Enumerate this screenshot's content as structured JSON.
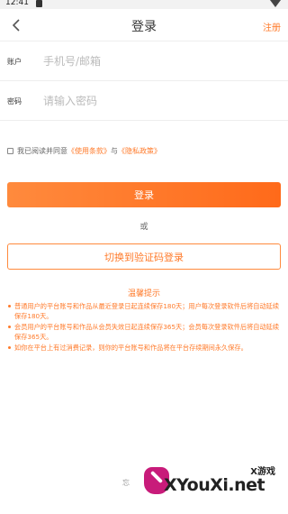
{
  "statusbar": {
    "time": "12:41"
  },
  "header": {
    "title": "登录",
    "register_label": "注册"
  },
  "account": {
    "label": "账户",
    "placeholder": "手机号/邮箱"
  },
  "password": {
    "label": "密码",
    "placeholder": "请输入密码"
  },
  "agreement": {
    "prefix": "我已阅读并同意",
    "terms": "《使用条款》",
    "and": "与",
    "privacy": "《隐私政策》"
  },
  "login_button": "登录",
  "or_text": "或",
  "switch_button": "切换到验证码登录",
  "tips": {
    "title": "温馨提示",
    "items": [
      "普通用户的平台账号和作品从最近登录日起连续保存180天；用户每次登录软件后将自动延续保存180天。",
      "会员用户的平台账号和作品从会员失效日起连续保存365天；会员每次登录软件后将自动延续保存365天。",
      "如你在平台上有过消费记录，则你的平台账号和作品将在平台存续期间永久保存。"
    ]
  },
  "forgot_partial": "忘",
  "watermark": {
    "brand": "XYouXi.net",
    "sub": "X游戏"
  },
  "colors": {
    "accent": "#ff7a2a",
    "button_gradient_start": "#ff8a3d",
    "button_gradient_end": "#ff6a1a"
  }
}
